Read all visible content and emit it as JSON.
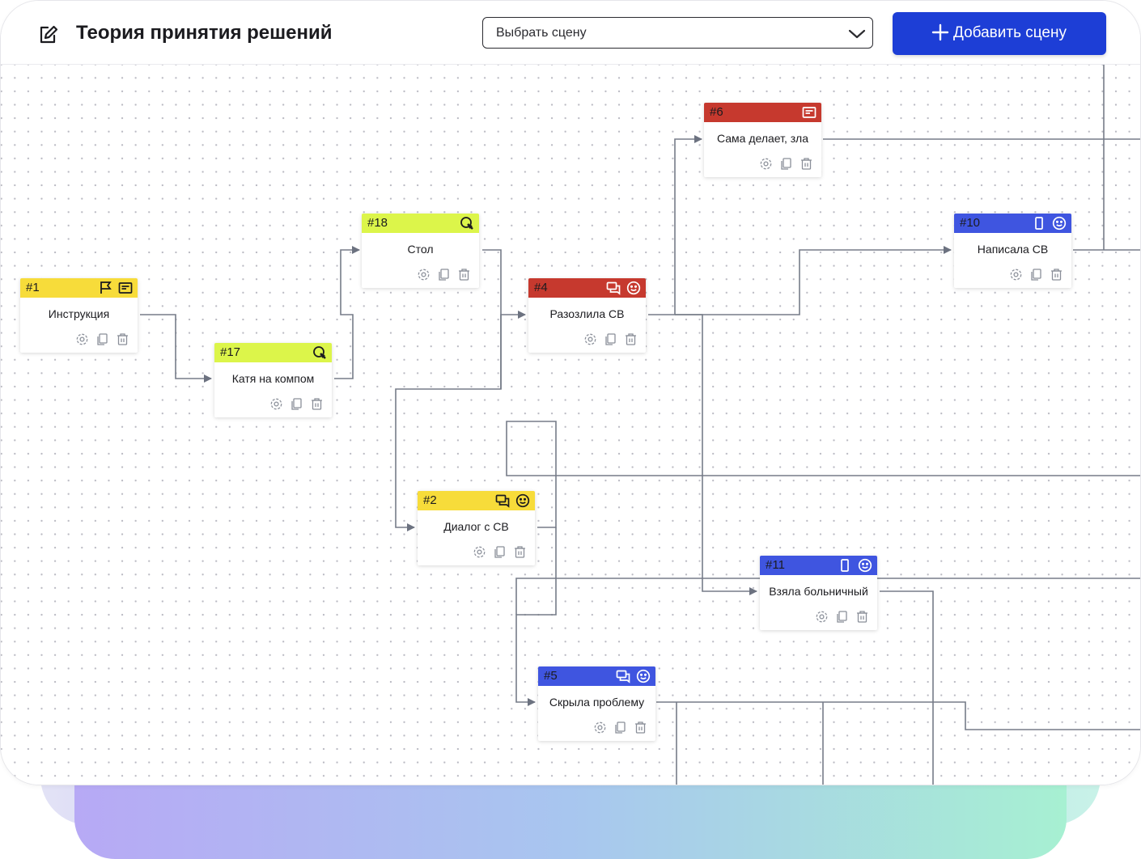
{
  "header": {
    "title": "Теория принятия решений",
    "scene_select_placeholder": "Выбрать сцену",
    "add_scene_label": "Добавить сцену"
  },
  "colors": {
    "yellow": "#f7dc3a",
    "lime": "#dcf54a",
    "red": "#c6392e",
    "blue": "#3f55e0",
    "button": "#1d3ed6"
  },
  "nodes": [
    {
      "id": "#1",
      "label": "Инструкция",
      "color": "yellow",
      "icons": [
        "flag-icon",
        "dialog-card-icon"
      ]
    },
    {
      "id": "#17",
      "label": "Катя на компом",
      "color": "lime",
      "icons": [
        "cursor-search-icon"
      ]
    },
    {
      "id": "#18",
      "label": "Стол",
      "color": "lime",
      "icons": [
        "cursor-search-icon"
      ]
    },
    {
      "id": "#4",
      "label": "Разозлила СВ",
      "color": "red",
      "icons": [
        "chat-icon",
        "smile-icon"
      ]
    },
    {
      "id": "#6",
      "label": "Сама делает, зла",
      "color": "red",
      "icons": [
        "dialog-card-icon"
      ]
    },
    {
      "id": "#10",
      "label": "Написала СВ",
      "color": "blue",
      "icons": [
        "phone-icon",
        "smile-icon"
      ]
    },
    {
      "id": "#2",
      "label": "Диалог с СВ",
      "color": "yellow",
      "icons": [
        "chat-icon",
        "smile-icon"
      ]
    },
    {
      "id": "#11",
      "label": "Взяла больничный",
      "color": "blue",
      "icons": [
        "phone-icon",
        "smile-icon"
      ]
    },
    {
      "id": "#5",
      "label": "Скрыла проблему",
      "color": "blue",
      "icons": [
        "chat-icon",
        "smile-icon"
      ]
    }
  ],
  "node_actions": [
    "settings-icon",
    "copy-icon",
    "delete-icon"
  ]
}
